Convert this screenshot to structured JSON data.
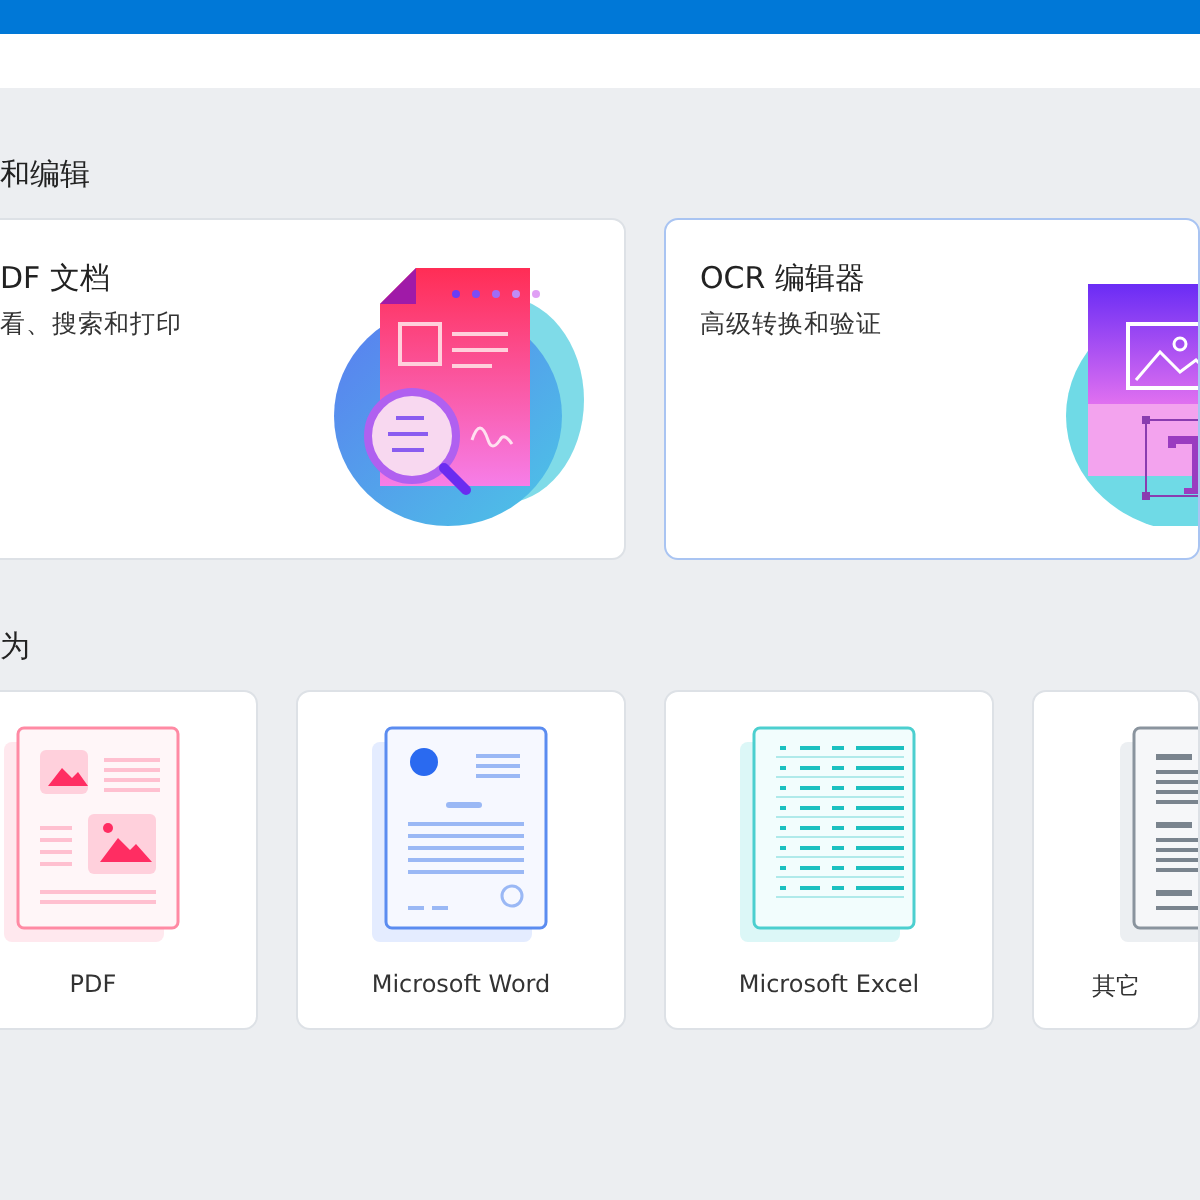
{
  "sections": [
    {
      "heading": "和编辑",
      "kind": "large",
      "cards": [
        {
          "title": "DF 文档",
          "subtitle": "看、搜索和打印",
          "kind": "pdf",
          "selected": false
        },
        {
          "title": "OCR 编辑器",
          "subtitle": "高级转换和验证",
          "kind": "ocr",
          "selected": true
        }
      ]
    },
    {
      "heading": "为",
      "kind": "small",
      "cards": [
        {
          "label": "PDF",
          "kind": "pdf"
        },
        {
          "label": "Microsoft Word",
          "kind": "word"
        },
        {
          "label": "Microsoft Excel",
          "kind": "excel"
        },
        {
          "label": "其它",
          "kind": "other"
        }
      ]
    }
  ]
}
